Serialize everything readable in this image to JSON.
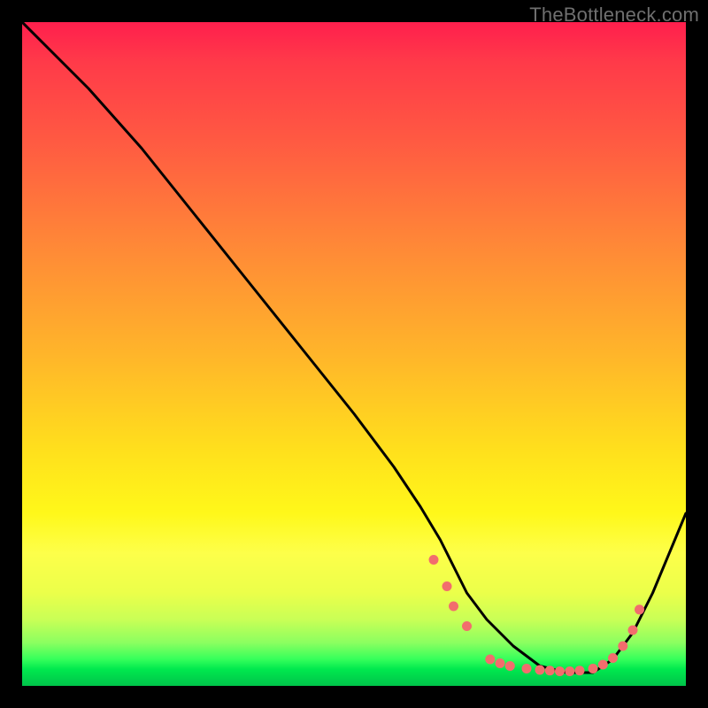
{
  "watermark": "TheBottleneck.com",
  "chart_data": {
    "type": "line",
    "title": "",
    "xlabel": "",
    "ylabel": "",
    "xlim": [
      0,
      100
    ],
    "ylim": [
      0,
      100
    ],
    "series": [
      {
        "name": "curve",
        "color": "#000000",
        "x": [
          0,
          4,
          10,
          18,
          26,
          34,
          42,
          50,
          56,
          60,
          63,
          65,
          67,
          70,
          74,
          78,
          82,
          86,
          89,
          92,
          95,
          100
        ],
        "y": [
          100,
          96,
          90,
          81,
          71,
          61,
          51,
          41,
          33,
          27,
          22,
          18,
          14,
          10,
          6,
          3,
          2,
          2,
          4,
          8,
          14,
          26
        ]
      }
    ],
    "markers": {
      "name": "dots",
      "color": "#f26d6d",
      "x": [
        62,
        64,
        65,
        67,
        70.5,
        72,
        73.5,
        76,
        78,
        79.5,
        81,
        82.5,
        84,
        86,
        87.5,
        89,
        90.5,
        92,
        93
      ],
      "y": [
        19,
        15,
        12,
        9,
        4,
        3.4,
        3.0,
        2.6,
        2.4,
        2.3,
        2.2,
        2.2,
        2.3,
        2.6,
        3.2,
        4.2,
        6.0,
        8.4,
        11.5
      ]
    },
    "gradient_stops": [
      {
        "pct": 0,
        "color": "#ff1f4d"
      },
      {
        "pct": 18,
        "color": "#ff5a42"
      },
      {
        "pct": 50,
        "color": "#ffb52a"
      },
      {
        "pct": 74,
        "color": "#fff81a"
      },
      {
        "pct": 90,
        "color": "#c9ff56"
      },
      {
        "pct": 96,
        "color": "#35ff5b"
      },
      {
        "pct": 100,
        "color": "#00c44a"
      }
    ]
  }
}
